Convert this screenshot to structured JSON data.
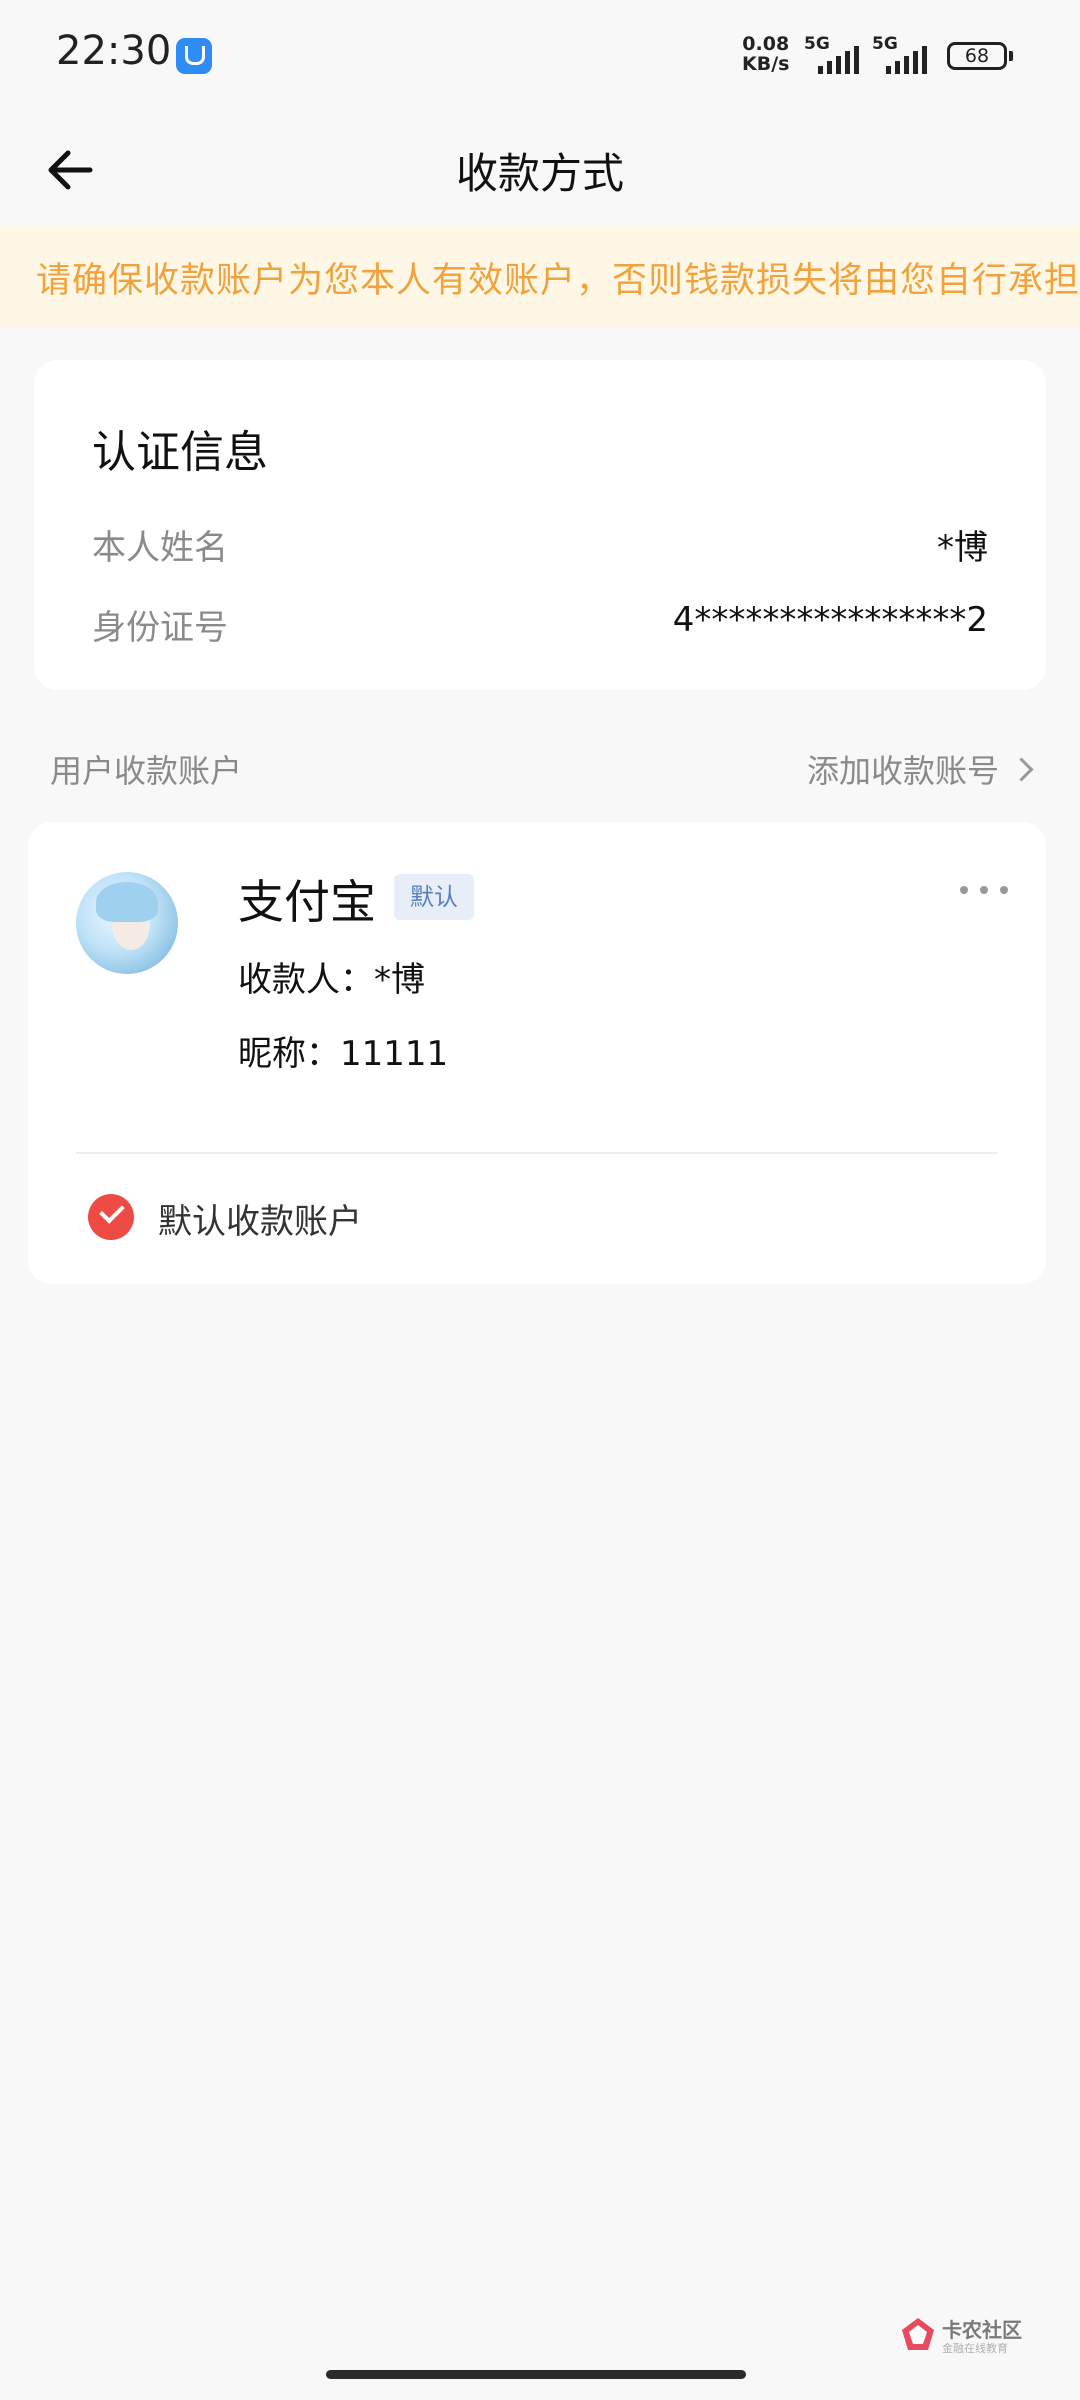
{
  "status_bar": {
    "time": "22:30",
    "app_icon": "notification-app-icon",
    "net_speed_value": "0.08",
    "net_speed_unit": "KB/s",
    "sim1_label": "5G",
    "sim2_label": "5G",
    "battery": "68"
  },
  "header": {
    "back_icon": "arrow-left-icon",
    "title": "收款方式"
  },
  "notice": {
    "text": "请确保收款账户为您本人有效账户，否则钱款损失将由您自行承担。",
    "color": "#f2a23c",
    "background": "#fff7e6"
  },
  "auth": {
    "title": "认证信息",
    "name_label": "本人姓名",
    "name_value": "*博",
    "id_label": "身份证号",
    "id_value": "4****************2"
  },
  "accounts_section": {
    "title": "用户收款账户",
    "add_link": "添加收款账号"
  },
  "account": {
    "name": "支付宝",
    "badge": "默认",
    "payee": "收款人：*博",
    "nickname": "昵称：11111",
    "default_label": "默认收款账户",
    "check_color": "#ee4b45"
  },
  "watermark": {
    "text": "卡农社区",
    "sub": "金融在线教育"
  }
}
